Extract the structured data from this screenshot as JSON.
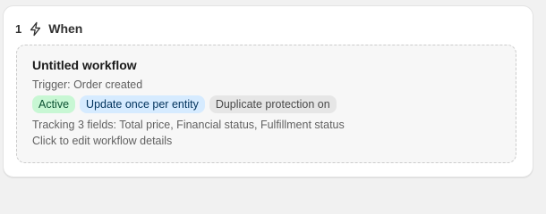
{
  "step": {
    "number": "1",
    "title": "When",
    "icon": "lightning-bolt-icon"
  },
  "workflow": {
    "title": "Untitled workflow",
    "trigger": "Trigger: Order created",
    "badges": [
      {
        "label": "Active",
        "color": "#c8f7d4"
      },
      {
        "label": "Update once per entity",
        "color": "#d6ebff"
      },
      {
        "label": "Duplicate protection on",
        "color": "#e6e6e6"
      }
    ],
    "tracking": "Tracking 3 fields: Total price, Financial status, Fulfillment status",
    "edit_hint": "Click to edit workflow details"
  }
}
